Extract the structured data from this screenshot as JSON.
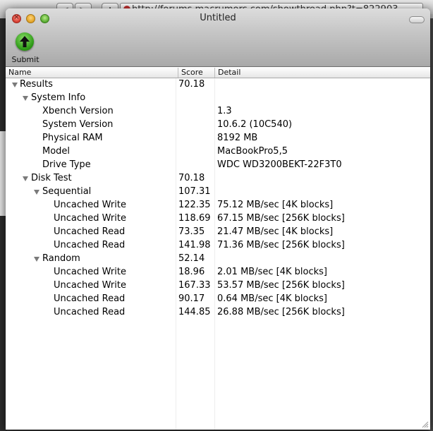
{
  "browser": {
    "back_glyph": "◀",
    "forward_glyph": "▶",
    "new_tab_glyph": "+",
    "url": "http://forums.macrumors.com/showthread.php?t=822903"
  },
  "window": {
    "title": "Untitled",
    "close_glyph": "×"
  },
  "toolbar": {
    "submit_label": "Submit"
  },
  "table": {
    "headers": {
      "name": "Name",
      "score": "Score",
      "detail": "Detail"
    },
    "rows": [
      {
        "name": "Results",
        "score": "70.18",
        "detail": ""
      },
      {
        "name": "System Info",
        "score": "",
        "detail": ""
      },
      {
        "name": "Xbench Version",
        "score": "",
        "detail": "1.3"
      },
      {
        "name": "System Version",
        "score": "",
        "detail": "10.6.2 (10C540)"
      },
      {
        "name": "Physical RAM",
        "score": "",
        "detail": "8192 MB"
      },
      {
        "name": "Model",
        "score": "",
        "detail": "MacBookPro5,5"
      },
      {
        "name": "Drive Type",
        "score": "",
        "detail": "WDC WD3200BEKT-22F3T0"
      },
      {
        "name": "Disk Test",
        "score": "70.18",
        "detail": ""
      },
      {
        "name": "Sequential",
        "score": "107.31",
        "detail": ""
      },
      {
        "name": "Uncached Write",
        "score": "122.35",
        "detail": "75.12 MB/sec [4K blocks]"
      },
      {
        "name": "Uncached Write",
        "score": "118.69",
        "detail": "67.15 MB/sec [256K blocks]"
      },
      {
        "name": "Uncached Read",
        "score": "73.35",
        "detail": "21.47 MB/sec [4K blocks]"
      },
      {
        "name": "Uncached Read",
        "score": "141.98",
        "detail": "71.36 MB/sec [256K blocks]"
      },
      {
        "name": "Random",
        "score": "52.14",
        "detail": ""
      },
      {
        "name": "Uncached Write",
        "score": "18.96",
        "detail": "2.01 MB/sec [4K blocks]"
      },
      {
        "name": "Uncached Write",
        "score": "167.33",
        "detail": "53.57 MB/sec [256K blocks]"
      },
      {
        "name": "Uncached Read",
        "score": "90.17",
        "detail": "0.64 MB/sec [4K blocks]"
      },
      {
        "name": "Uncached Read",
        "score": "144.85",
        "detail": "26.88 MB/sec [256K blocks]"
      }
    ]
  }
}
